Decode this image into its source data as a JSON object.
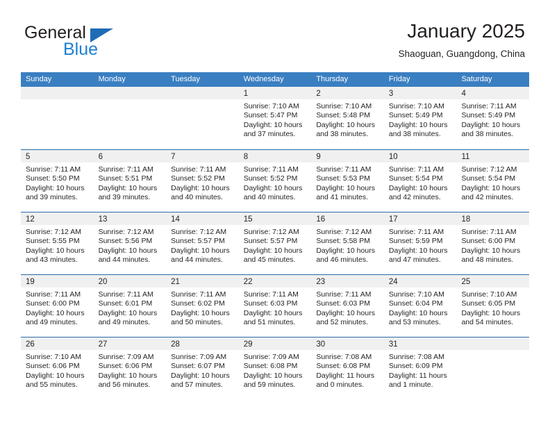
{
  "brand": {
    "name_part1": "General",
    "name_part2": "Blue",
    "logo_icon": "triangle-flag-icon",
    "accent_color": "#1d7fd0"
  },
  "header": {
    "title": "January 2025",
    "subtitle": "Shaoguan, Guangdong, China"
  },
  "calendar": {
    "header_bg": "#3a7fc1",
    "band_bg": "#f0f0f0",
    "weekdays": [
      "Sunday",
      "Monday",
      "Tuesday",
      "Wednesday",
      "Thursday",
      "Friday",
      "Saturday"
    ],
    "weeks": [
      [
        {
          "day": "",
          "lines": []
        },
        {
          "day": "",
          "lines": []
        },
        {
          "day": "",
          "lines": []
        },
        {
          "day": "1",
          "lines": [
            "Sunrise: 7:10 AM",
            "Sunset: 5:47 PM",
            "Daylight: 10 hours",
            "and 37 minutes."
          ]
        },
        {
          "day": "2",
          "lines": [
            "Sunrise: 7:10 AM",
            "Sunset: 5:48 PM",
            "Daylight: 10 hours",
            "and 38 minutes."
          ]
        },
        {
          "day": "3",
          "lines": [
            "Sunrise: 7:10 AM",
            "Sunset: 5:49 PM",
            "Daylight: 10 hours",
            "and 38 minutes."
          ]
        },
        {
          "day": "4",
          "lines": [
            "Sunrise: 7:11 AM",
            "Sunset: 5:49 PM",
            "Daylight: 10 hours",
            "and 38 minutes."
          ]
        }
      ],
      [
        {
          "day": "5",
          "lines": [
            "Sunrise: 7:11 AM",
            "Sunset: 5:50 PM",
            "Daylight: 10 hours",
            "and 39 minutes."
          ]
        },
        {
          "day": "6",
          "lines": [
            "Sunrise: 7:11 AM",
            "Sunset: 5:51 PM",
            "Daylight: 10 hours",
            "and 39 minutes."
          ]
        },
        {
          "day": "7",
          "lines": [
            "Sunrise: 7:11 AM",
            "Sunset: 5:52 PM",
            "Daylight: 10 hours",
            "and 40 minutes."
          ]
        },
        {
          "day": "8",
          "lines": [
            "Sunrise: 7:11 AM",
            "Sunset: 5:52 PM",
            "Daylight: 10 hours",
            "and 40 minutes."
          ]
        },
        {
          "day": "9",
          "lines": [
            "Sunrise: 7:11 AM",
            "Sunset: 5:53 PM",
            "Daylight: 10 hours",
            "and 41 minutes."
          ]
        },
        {
          "day": "10",
          "lines": [
            "Sunrise: 7:11 AM",
            "Sunset: 5:54 PM",
            "Daylight: 10 hours",
            "and 42 minutes."
          ]
        },
        {
          "day": "11",
          "lines": [
            "Sunrise: 7:12 AM",
            "Sunset: 5:54 PM",
            "Daylight: 10 hours",
            "and 42 minutes."
          ]
        }
      ],
      [
        {
          "day": "12",
          "lines": [
            "Sunrise: 7:12 AM",
            "Sunset: 5:55 PM",
            "Daylight: 10 hours",
            "and 43 minutes."
          ]
        },
        {
          "day": "13",
          "lines": [
            "Sunrise: 7:12 AM",
            "Sunset: 5:56 PM",
            "Daylight: 10 hours",
            "and 44 minutes."
          ]
        },
        {
          "day": "14",
          "lines": [
            "Sunrise: 7:12 AM",
            "Sunset: 5:57 PM",
            "Daylight: 10 hours",
            "and 44 minutes."
          ]
        },
        {
          "day": "15",
          "lines": [
            "Sunrise: 7:12 AM",
            "Sunset: 5:57 PM",
            "Daylight: 10 hours",
            "and 45 minutes."
          ]
        },
        {
          "day": "16",
          "lines": [
            "Sunrise: 7:12 AM",
            "Sunset: 5:58 PM",
            "Daylight: 10 hours",
            "and 46 minutes."
          ]
        },
        {
          "day": "17",
          "lines": [
            "Sunrise: 7:11 AM",
            "Sunset: 5:59 PM",
            "Daylight: 10 hours",
            "and 47 minutes."
          ]
        },
        {
          "day": "18",
          "lines": [
            "Sunrise: 7:11 AM",
            "Sunset: 6:00 PM",
            "Daylight: 10 hours",
            "and 48 minutes."
          ]
        }
      ],
      [
        {
          "day": "19",
          "lines": [
            "Sunrise: 7:11 AM",
            "Sunset: 6:00 PM",
            "Daylight: 10 hours",
            "and 49 minutes."
          ]
        },
        {
          "day": "20",
          "lines": [
            "Sunrise: 7:11 AM",
            "Sunset: 6:01 PM",
            "Daylight: 10 hours",
            "and 49 minutes."
          ]
        },
        {
          "day": "21",
          "lines": [
            "Sunrise: 7:11 AM",
            "Sunset: 6:02 PM",
            "Daylight: 10 hours",
            "and 50 minutes."
          ]
        },
        {
          "day": "22",
          "lines": [
            "Sunrise: 7:11 AM",
            "Sunset: 6:03 PM",
            "Daylight: 10 hours",
            "and 51 minutes."
          ]
        },
        {
          "day": "23",
          "lines": [
            "Sunrise: 7:11 AM",
            "Sunset: 6:03 PM",
            "Daylight: 10 hours",
            "and 52 minutes."
          ]
        },
        {
          "day": "24",
          "lines": [
            "Sunrise: 7:10 AM",
            "Sunset: 6:04 PM",
            "Daylight: 10 hours",
            "and 53 minutes."
          ]
        },
        {
          "day": "25",
          "lines": [
            "Sunrise: 7:10 AM",
            "Sunset: 6:05 PM",
            "Daylight: 10 hours",
            "and 54 minutes."
          ]
        }
      ],
      [
        {
          "day": "26",
          "lines": [
            "Sunrise: 7:10 AM",
            "Sunset: 6:06 PM",
            "Daylight: 10 hours",
            "and 55 minutes."
          ]
        },
        {
          "day": "27",
          "lines": [
            "Sunrise: 7:09 AM",
            "Sunset: 6:06 PM",
            "Daylight: 10 hours",
            "and 56 minutes."
          ]
        },
        {
          "day": "28",
          "lines": [
            "Sunrise: 7:09 AM",
            "Sunset: 6:07 PM",
            "Daylight: 10 hours",
            "and 57 minutes."
          ]
        },
        {
          "day": "29",
          "lines": [
            "Sunrise: 7:09 AM",
            "Sunset: 6:08 PM",
            "Daylight: 10 hours",
            "and 59 minutes."
          ]
        },
        {
          "day": "30",
          "lines": [
            "Sunrise: 7:08 AM",
            "Sunset: 6:08 PM",
            "Daylight: 11 hours",
            "and 0 minutes."
          ]
        },
        {
          "day": "31",
          "lines": [
            "Sunrise: 7:08 AM",
            "Sunset: 6:09 PM",
            "Daylight: 11 hours",
            "and 1 minute."
          ]
        },
        {
          "day": "",
          "lines": []
        }
      ]
    ]
  }
}
